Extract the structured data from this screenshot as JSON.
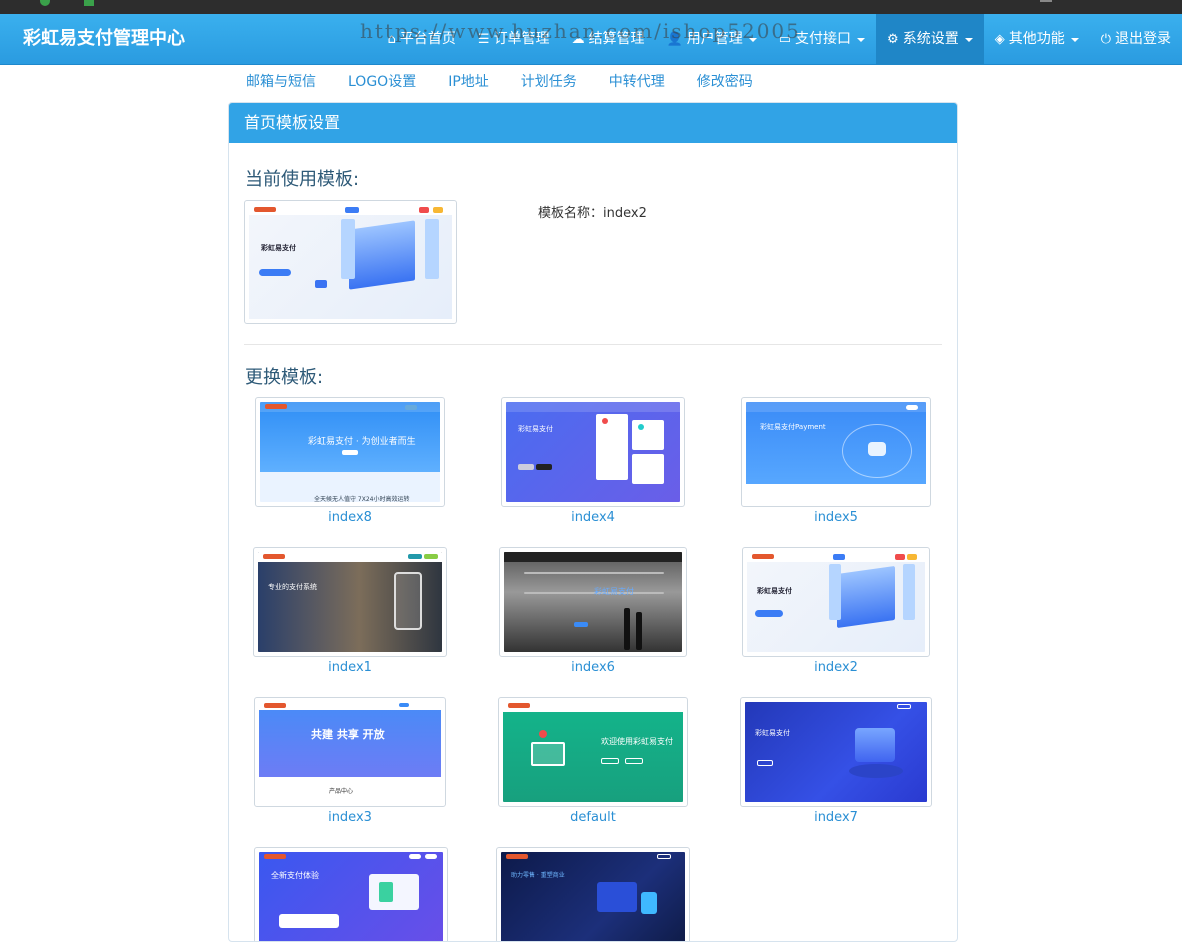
{
  "navbar": {
    "brand": "彩虹易支付管理中心",
    "items": [
      {
        "icon": "home-icon",
        "glyph": "⌂",
        "label": "平台首页",
        "dropdown": false
      },
      {
        "icon": "list-icon",
        "glyph": "☰",
        "label": "订单管理",
        "dropdown": false
      },
      {
        "icon": "cloud-icon",
        "glyph": "☁",
        "label": "结算管理",
        "dropdown": false
      },
      {
        "icon": "user-icon",
        "glyph": "👤",
        "label": "用户管理",
        "dropdown": true
      },
      {
        "icon": "card-icon",
        "glyph": "▭",
        "label": "支付接口",
        "dropdown": true
      },
      {
        "icon": "gear-icon",
        "glyph": "⚙",
        "label": "系统设置",
        "dropdown": true
      },
      {
        "icon": "cube-icon",
        "glyph": "◈",
        "label": "其他功能",
        "dropdown": true
      },
      {
        "icon": "power-icon",
        "glyph": "⏻",
        "label": "退出登录",
        "dropdown": false
      }
    ],
    "watermark": "https://www.huzhan.com/ishop52005"
  },
  "subnav": [
    "邮箱与短信",
    "LOGO设置",
    "IP地址",
    "计划任务",
    "中转代理",
    "修改密码"
  ],
  "panel": {
    "title": "首页模板设置",
    "current_heading": "当前使用模板:",
    "template_name_label": "模板名称：index2",
    "change_heading": "更换模板:"
  },
  "templates": [
    {
      "name": "index8",
      "caption": "彩虹易支付 · 为创业者而生"
    },
    {
      "name": "index4",
      "caption": "彩虹易支付"
    },
    {
      "name": "index5",
      "caption": "彩虹易支付Payment"
    },
    {
      "name": "index1",
      "caption": "专业的支付系统"
    },
    {
      "name": "index6",
      "caption": "彩虹易支付"
    },
    {
      "name": "index2",
      "caption": "彩虹易支付"
    },
    {
      "name": "index3",
      "caption": "共建  共享  开放"
    },
    {
      "name": "default",
      "caption": "欢迎使用彩虹易支付"
    },
    {
      "name": "index7",
      "caption": "彩虹易支付"
    },
    {
      "name": "",
      "caption": "全新支付体验"
    },
    {
      "name": "",
      "caption": ""
    }
  ],
  "colors": {
    "navbar": "#2fa5e8",
    "accent": "#2a8fd4",
    "panel_head": "#31a3e6"
  }
}
